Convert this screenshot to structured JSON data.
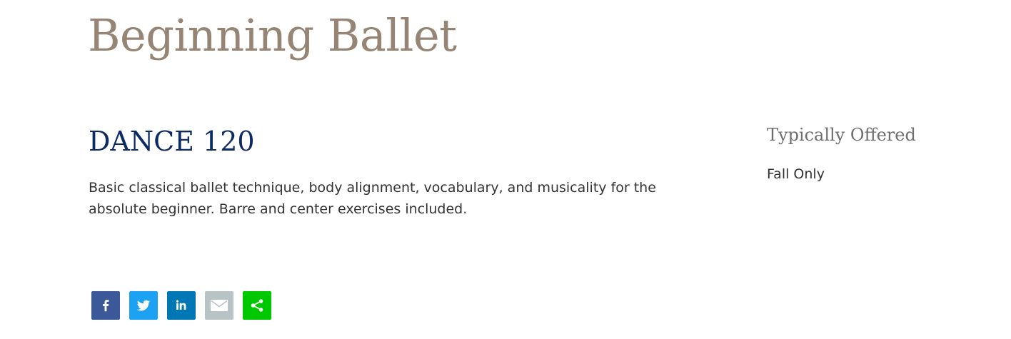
{
  "page": {
    "title": "Beginning Ballet"
  },
  "course": {
    "code": "DANCE 120",
    "description": "Basic classical ballet technique, body alignment, vocabulary, and musicality for the absolute beginner. Barre and center exercises included."
  },
  "sidebar": {
    "heading": "Typically Offered",
    "value": "Fall Only"
  },
  "share": {
    "buttons": [
      {
        "name": "facebook",
        "icon": "facebook-icon",
        "color": "#3b5998"
      },
      {
        "name": "twitter",
        "icon": "twitter-icon",
        "color": "#1da1f2"
      },
      {
        "name": "linkedin",
        "icon": "linkedin-icon",
        "color": "#0077b5"
      },
      {
        "name": "email",
        "icon": "email-icon",
        "color": "#b8c3c6"
      },
      {
        "name": "share",
        "icon": "share-icon",
        "color": "#00c800"
      }
    ]
  },
  "colors": {
    "title": "#968574",
    "course_code": "#0c2a66",
    "sidebar_heading": "#6e6e6e",
    "body_text": "#333333"
  }
}
